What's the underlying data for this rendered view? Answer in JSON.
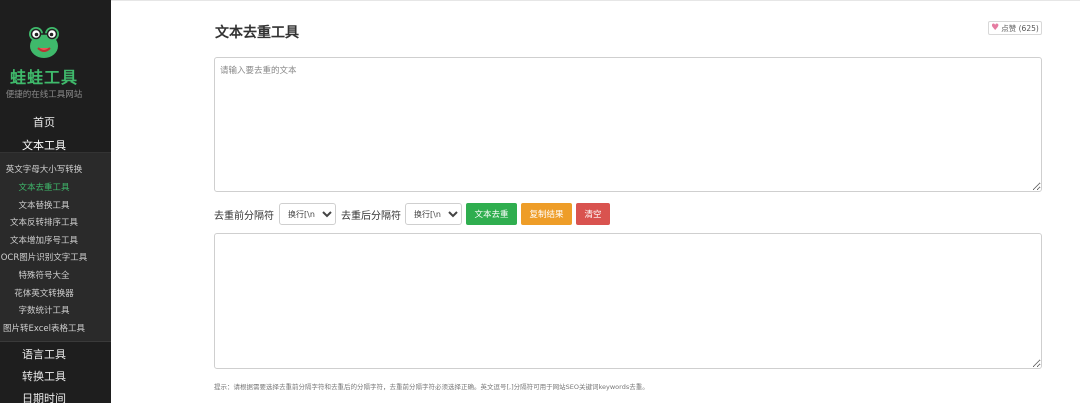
{
  "sidebar": {
    "brand": "蛙蛙工具",
    "tagline": "便捷的在线工具网站",
    "nav_home": "首页",
    "nav_text_tools": "文本工具",
    "submenu": [
      "英文字母大小写转换",
      "文本去重工具",
      "文本替换工具",
      "文本反转排序工具",
      "文本增加序号工具",
      "OCR图片识别文字工具",
      "特殊符号大全",
      "花体英文转换器",
      "字数统计工具",
      "图片转Excel表格工具"
    ],
    "active_submenu": "文本去重工具",
    "nav_language": "语言工具",
    "nav_convert": "转换工具",
    "nav_date": "日期时间"
  },
  "main": {
    "title": "文本去重工具",
    "like_label": "点赞 (625)",
    "input_placeholder": "请输入要去重的文本",
    "output_value": "",
    "sep_before_label": "去重前分隔符",
    "sep_before_value": "换行[\\n]",
    "sep_after_label": "去重后分隔符",
    "sep_after_value": "换行[\\n]",
    "btn_dedupe": "文本去重",
    "btn_copy": "复制结果",
    "btn_clear": "清空",
    "tip": "提示：请根据需要选择去重前分隔字符和去重后的分隔字符，去重前分隔字符必须选择正确。英文逗号[,]分隔符可用于网站SEO关键词keywords去重。"
  },
  "colors": {
    "sidebar_bg": "#1e1e1e",
    "brand_green": "#3fb96b",
    "btn_green": "#2fae4f",
    "btn_orange": "#ee9d28",
    "btn_red": "#d9534f",
    "heart": "#e57ca1"
  },
  "icons": {
    "logo": "frog-logo-icon",
    "like": "heart-icon",
    "resize": "resize-handle-icon"
  }
}
